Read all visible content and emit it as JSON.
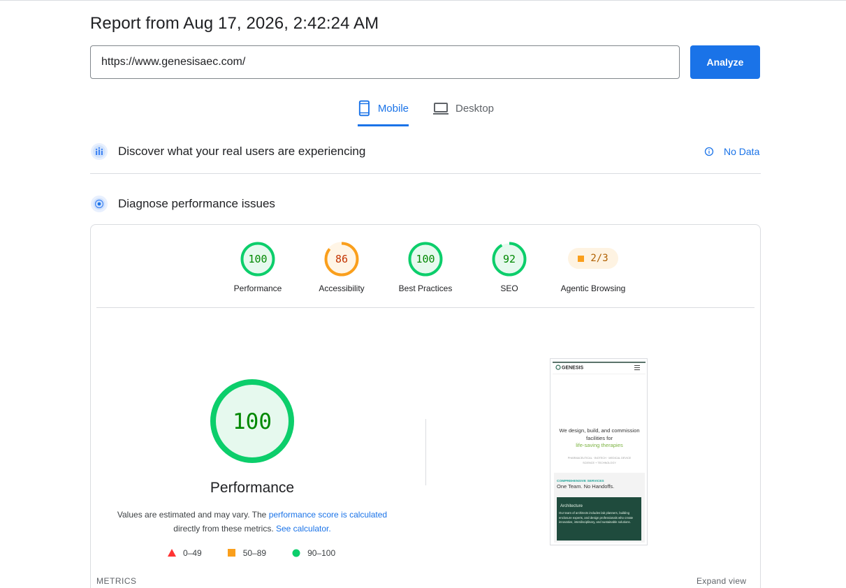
{
  "report": {
    "title": "Report from Aug 17, 2026, 2:42:24 AM"
  },
  "search": {
    "url": "https://www.genesisaec.com/",
    "analyze_label": "Analyze"
  },
  "tabs": [
    {
      "label": "Mobile",
      "active": true
    },
    {
      "label": "Desktop",
      "active": false
    }
  ],
  "field_data": {
    "title": "Discover what your real users are experiencing",
    "status": "No Data"
  },
  "diagnose": {
    "title": "Diagnose performance issues"
  },
  "categories": [
    {
      "label": "Performance",
      "score": "100",
      "color": "#0cce6b"
    },
    {
      "label": "Accessibility",
      "score": "86",
      "color": "#fa9f1c"
    },
    {
      "label": "Best Practices",
      "score": "100",
      "color": "#0cce6b"
    },
    {
      "label": "SEO",
      "score": "92",
      "color": "#0cce6b"
    },
    {
      "label": "Agentic Browsing",
      "score": "2/3",
      "color": "#fa9f1c"
    }
  ],
  "performance": {
    "score": "100",
    "title": "Performance",
    "disclaimer_prefix": "Values are estimated and may vary. The",
    "disclaimer_link": "performance score is calculated",
    "disclaimer_mid": "directly from these metrics.",
    "calculator_link": "See calculator."
  },
  "legend": [
    {
      "range": "0–49",
      "color": "#ff3333",
      "shape": "triangle"
    },
    {
      "range": "50–89",
      "color": "#fa9f1c",
      "shape": "square"
    },
    {
      "range": "90–100",
      "color": "#0cce6b",
      "shape": "circle"
    }
  ],
  "screenshot": {
    "logo": "GENESIS",
    "headline": "We design, build, and commission facilities for",
    "headline_highlight": "life-saving therapies",
    "tags_line1": "PHARMACEUTICAL · BIOTECH · MEDICAL DEVICE",
    "tags_line2": "SCIENCE + TECHNOLOGY",
    "services_label": "COMPREHENSIVE SERVICES",
    "services_heading": "One Team. No Handoffs.",
    "card_title": "Architecture",
    "card_text": "Our team of architects includes lab planners, building enclosure experts, and design professionals who create innovative, interdisciplinary, and sustainable solutions."
  },
  "footer": {
    "metrics_label": "METRICS",
    "expand_label": "Expand view"
  }
}
